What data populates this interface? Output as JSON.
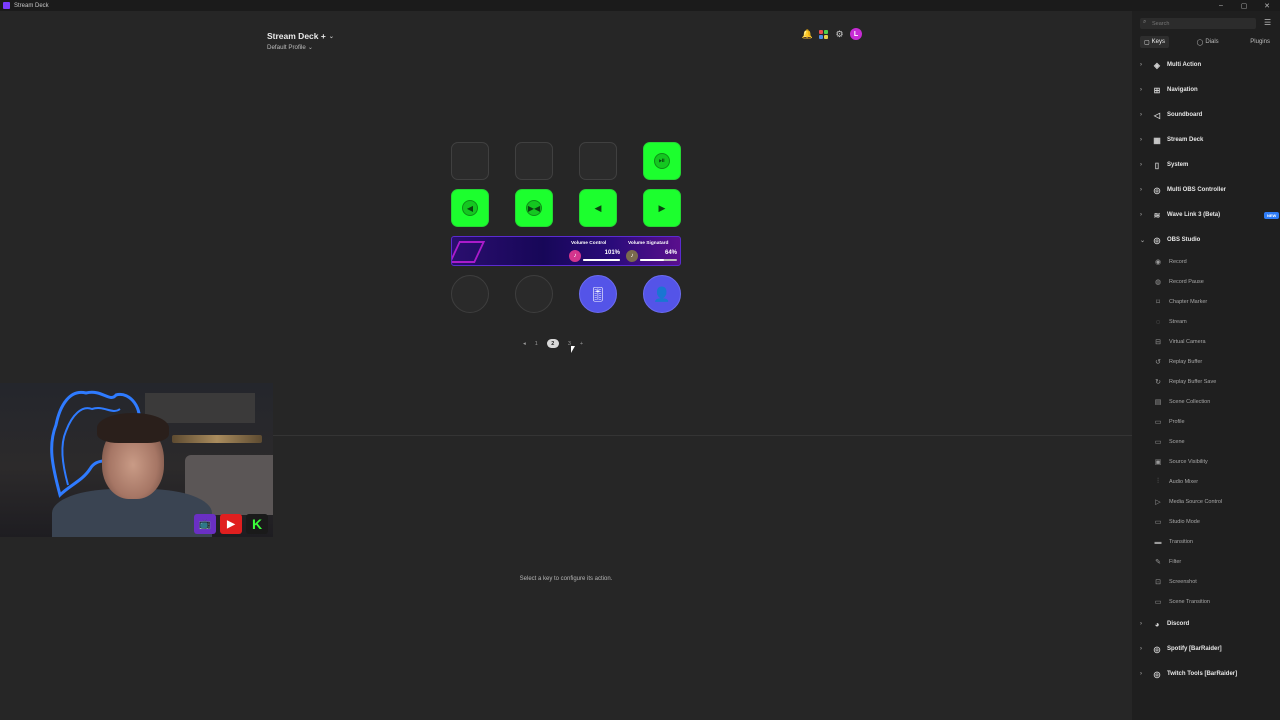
{
  "window": {
    "title": "Stream Deck",
    "controls": [
      "–",
      "▢",
      "✕"
    ]
  },
  "header": {
    "device": "Stream Deck +",
    "profile": "Default Profile"
  },
  "top_icons": {
    "bell": "🔔",
    "settings": "⚙",
    "avatar_letter": "L",
    "grid_colors": [
      "#e84d4d",
      "#4dd14d",
      "#4d8ee8",
      "#e8d24d"
    ]
  },
  "keys": {
    "row1": [
      {
        "type": "empty"
      },
      {
        "type": "empty"
      },
      {
        "type": "empty"
      },
      {
        "type": "green",
        "glyph": "⏯"
      }
    ],
    "row2": [
      {
        "type": "green",
        "glyph": "◀"
      },
      {
        "type": "green",
        "glyph": "▶◀"
      },
      {
        "type": "green",
        "glyph": "◀"
      },
      {
        "type": "green",
        "glyph": "▶"
      }
    ]
  },
  "touchstrip": {
    "seg1": {
      "title": "Volume Control",
      "value": "101%",
      "level": 1.0
    },
    "seg2": {
      "title": "Volume Signatard",
      "value": "64%",
      "level": 0.64
    }
  },
  "dials": {
    "dial3_glyph": "🎚",
    "dial4_glyph": "👤"
  },
  "pager": {
    "prev": "◂",
    "p1": "1",
    "p2": "2",
    "p3": "3",
    "add": "+"
  },
  "hint": "Select a key to configure its action.",
  "webcam": {
    "social1": "📺",
    "social2": "▶",
    "social3": "K"
  },
  "sidebar": {
    "search_placeholder": "Search",
    "tabs": {
      "keys": "Keys",
      "dials": "Dials",
      "plugins": "Plugins"
    },
    "categories": {
      "multi_action": "Multi Action",
      "navigation": "Navigation",
      "soundboard": "Soundboard",
      "stream_deck": "Stream Deck",
      "system": "System",
      "multi_obs": "Multi OBS Controller",
      "wave_link": "Wave Link 3 (Beta)",
      "wave_badge": "NEW",
      "obs_studio": "OBS Studio",
      "discord": "Discord",
      "spotify": "Spotify [BarRaider]",
      "twitch": "Twitch Tools [BarRaider]"
    },
    "obs_items": [
      "Record",
      "Record Pause",
      "Chapter Marker",
      "Stream",
      "Virtual Camera",
      "Replay Buffer",
      "Replay Buffer Save",
      "Scene Collection",
      "Profile",
      "Scene",
      "Source Visibility",
      "Audio Mixer",
      "Media Source Control",
      "Studio Mode",
      "Transition",
      "Filter",
      "Screenshot",
      "Scene Transition"
    ]
  }
}
